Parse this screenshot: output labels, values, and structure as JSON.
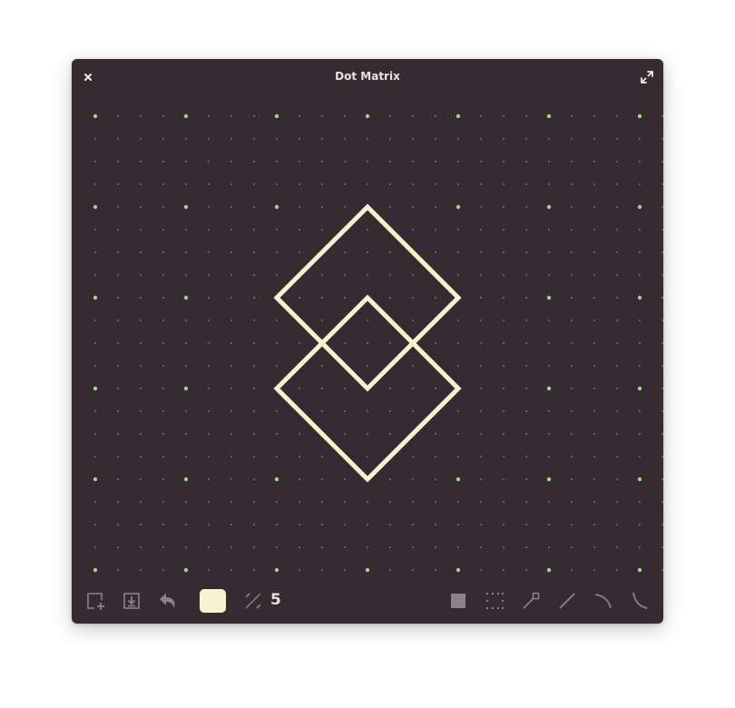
{
  "window": {
    "title": "Dot Matrix"
  },
  "colors": {
    "background": "#352b31",
    "dot_minor": "#6e6369",
    "dot_major": "#a6d38d",
    "stroke": "#f7f3d0",
    "icon": "#8d8288"
  },
  "toolbar": {
    "left_tools": [
      {
        "name": "new-canvas-icon"
      },
      {
        "name": "save-icon"
      },
      {
        "name": "undo-icon"
      }
    ],
    "color_swatch": "#f7f3d0",
    "thickness": {
      "icon": "thickness-icon",
      "value": "5"
    },
    "right_tools": [
      {
        "name": "filled-square-icon"
      },
      {
        "name": "grid-toggle-icon"
      },
      {
        "name": "eyedropper-icon"
      },
      {
        "name": "line-icon"
      },
      {
        "name": "curve-right-icon"
      },
      {
        "name": "curve-left-icon"
      }
    ]
  },
  "drawing": {
    "grid_major_every": 4,
    "shapes": [
      {
        "type": "polygon",
        "points": [
          [
            12,
            4
          ],
          [
            16,
            8
          ],
          [
            12,
            12
          ],
          [
            8,
            8
          ]
        ]
      },
      {
        "type": "polygon",
        "points": [
          [
            12,
            8
          ],
          [
            16,
            12
          ],
          [
            12,
            16
          ],
          [
            8,
            12
          ]
        ]
      }
    ]
  }
}
